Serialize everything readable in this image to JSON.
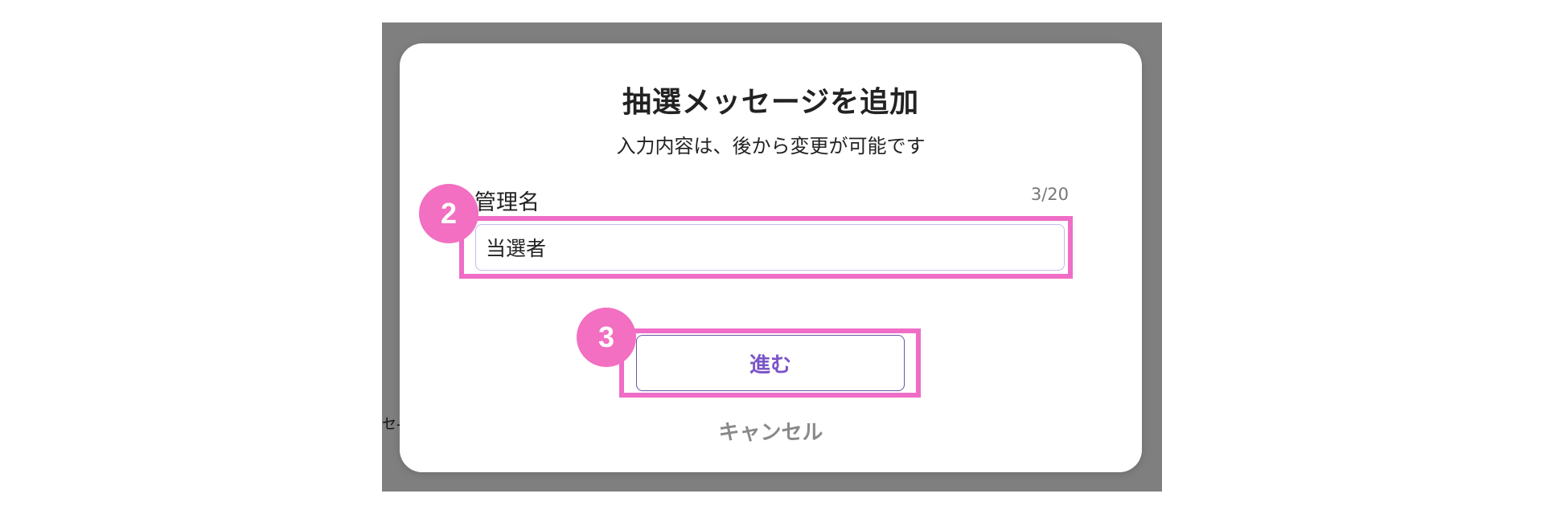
{
  "background": {
    "partial_text": "セ-"
  },
  "modal": {
    "title": "抽選メッセージを追加",
    "subtitle": "入力内容は、後から変更が可能です",
    "field": {
      "label": "管理名",
      "counter": "3/20",
      "value": "当選者"
    },
    "next_label": "進む",
    "cancel_label": "キャンセル"
  },
  "annotations": {
    "step_2": "2",
    "step_3": "3",
    "highlight_color": "#ef6dc6"
  }
}
